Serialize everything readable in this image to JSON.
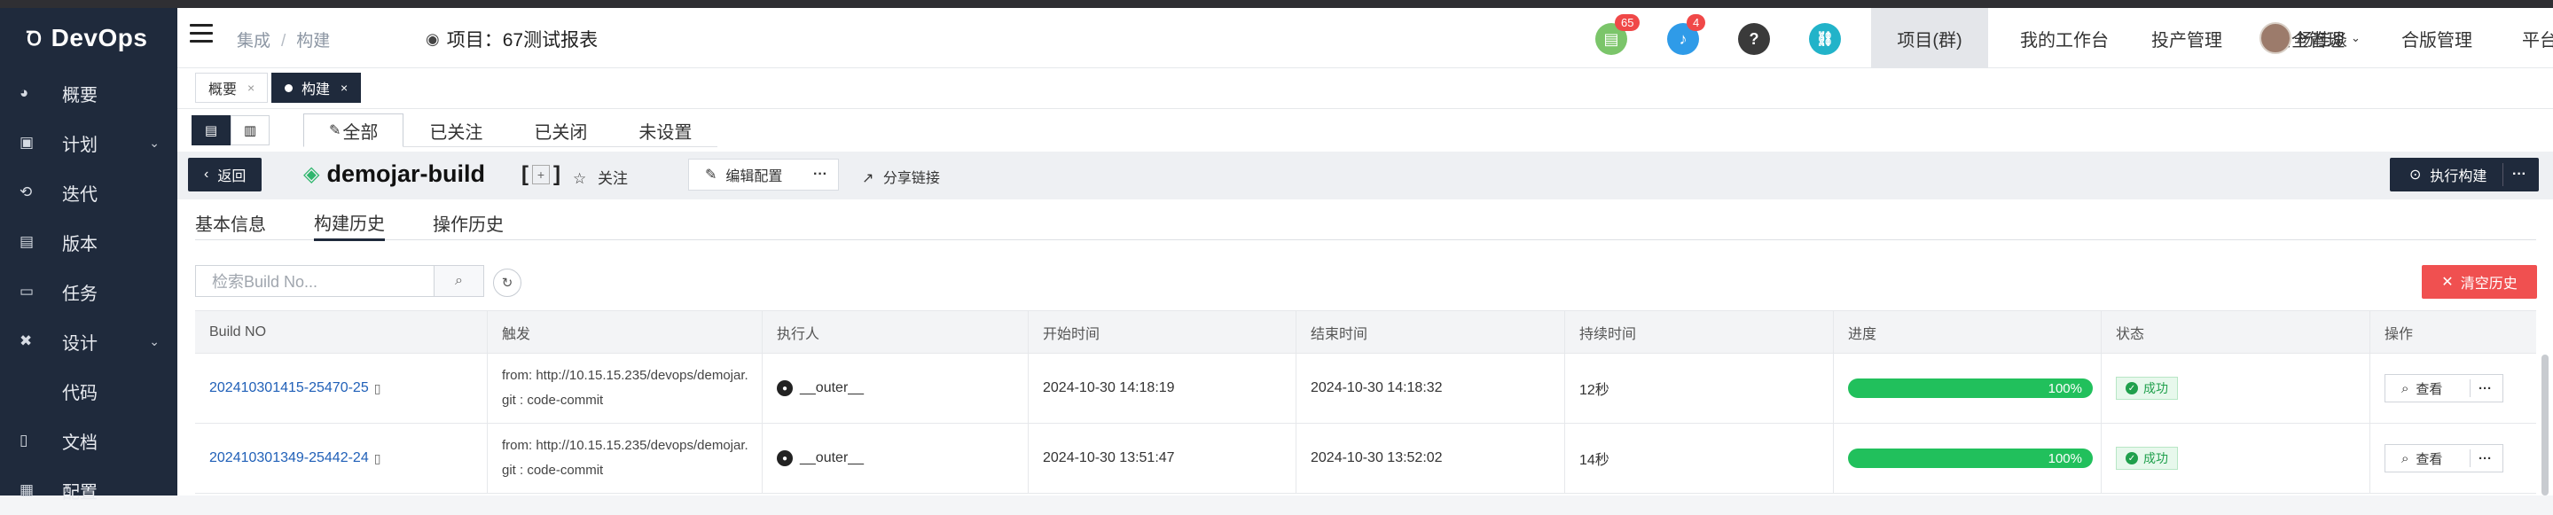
{
  "brand": {
    "name": "DevOps"
  },
  "sidebar": {
    "items": [
      {
        "label": "概要",
        "icon": "dashboard-icon",
        "glyph": "◕",
        "expandable": false
      },
      {
        "label": "计划",
        "icon": "plan-icon",
        "glyph": "▣",
        "expandable": true
      },
      {
        "label": "迭代",
        "icon": "iteration-icon",
        "glyph": "⟲",
        "expandable": false
      },
      {
        "label": "版本",
        "icon": "version-icon",
        "glyph": "▤",
        "expandable": false
      },
      {
        "label": "任务",
        "icon": "task-icon",
        "glyph": "▭",
        "expandable": false
      },
      {
        "label": "设计",
        "icon": "design-icon",
        "glyph": "✖",
        "expandable": true
      },
      {
        "label": "代码",
        "icon": "code-icon",
        "glyph": "</>",
        "expandable": false
      },
      {
        "label": "文档",
        "icon": "document-icon",
        "glyph": "▯",
        "expandable": false
      },
      {
        "label": "配置",
        "icon": "config-icon",
        "glyph": "▦",
        "expandable": false
      }
    ]
  },
  "header": {
    "breadcrumb": [
      "集成",
      "构建"
    ],
    "project_label": "项目：67测试报表",
    "icons": {
      "notes_badge": "65",
      "bell_badge": "4",
      "help": "?",
      "link": "🔗"
    },
    "nav": [
      "项目(群)",
      "我的工作台",
      "投产管理",
      "安全管理",
      "合版管理",
      "平台管理"
    ],
    "active_nav": "项目(群)",
    "user_name": "杨桂焱"
  },
  "tags": [
    {
      "label": "概要",
      "active": false
    },
    {
      "label": "构建",
      "active": true
    }
  ],
  "filter_tabs": [
    "全部",
    "已关注",
    "已关闭",
    "未设置"
  ],
  "job": {
    "back_label": "返回",
    "name": "demojar-build",
    "bracket_open": "[",
    "bracket_plus": "+",
    "bracket_close": "]",
    "follow_label": "关注",
    "edit_label": "编辑配置",
    "share_label": "分享链接",
    "run_label": "执行构建"
  },
  "subtabs": [
    "基本信息",
    "构建历史",
    "操作历史"
  ],
  "active_subtab": "构建历史",
  "search": {
    "placeholder": "检索Build No..."
  },
  "clear_label": "清空历史",
  "table": {
    "headers": [
      "Build NO",
      "触发",
      "执行人",
      "开始时间",
      "结束时间",
      "持续时间",
      "进度",
      "状态",
      "操作"
    ],
    "rows": [
      {
        "build_no": "202410301415-25470-25",
        "trigger": "from: http://10.15.15.235/devops/demojar.git : code-commit",
        "executor": "__outer__",
        "start": "2024-10-30 14:18:19",
        "end": "2024-10-30 14:18:32",
        "duration": "12秒",
        "progress": "100%",
        "status": "成功",
        "action": "查看"
      },
      {
        "build_no": "202410301349-25442-24",
        "trigger": "from: http://10.15.15.235/devops/demojar.git : code-commit",
        "executor": "__outer__",
        "start": "2024-10-30 13:51:47",
        "end": "2024-10-30 13:52:02",
        "duration": "14秒",
        "progress": "100%",
        "status": "成功",
        "action": "查看"
      }
    ]
  },
  "colors": {
    "sidebar_bg": "#1f2a3c",
    "success": "#21c05c",
    "danger": "#f05050",
    "link": "#2060b8"
  }
}
